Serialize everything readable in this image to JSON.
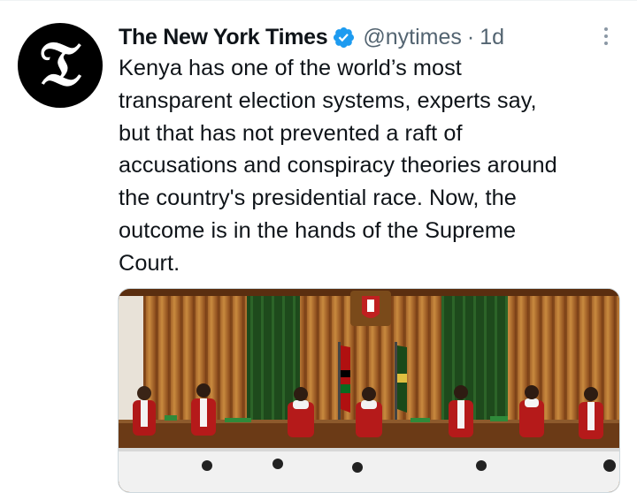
{
  "author": {
    "display_name": "The New York Times",
    "handle": "@nytimes",
    "separator": "·",
    "time": "1d",
    "avatar_icon": "nyt-logo-icon",
    "avatar_glyph": "𝔗",
    "verified_icon": "verified-badge-icon"
  },
  "tweet": {
    "lines": [
      "Kenya has one of the world’s most",
      "transparent election systems, experts say,",
      "but that has not prevented a raft of",
      "accusations and conspiracy theories around",
      "the country's presidential race. Now, the",
      "outcome is in the hands of the Supreme",
      "Court."
    ]
  },
  "media": {
    "type": "photo",
    "subject_icon": "courtroom-photo"
  },
  "colors": {
    "text": "#0f1419",
    "secondary": "#536471",
    "verified": "#1d9bf0",
    "avatar_bg": "#000000"
  }
}
